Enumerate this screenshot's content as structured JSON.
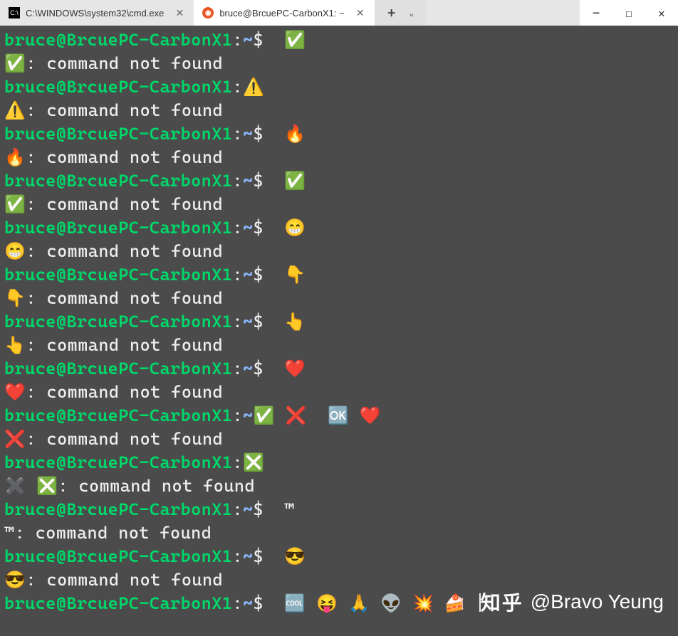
{
  "tabs": [
    {
      "title": "C:\\WINDOWS\\system32\\cmd.exe",
      "active": false,
      "icon": "cmd"
    },
    {
      "title": "bruce@BrcuePC-CarbonX1: ~",
      "active": true,
      "icon": "ubuntu"
    }
  ],
  "window": {
    "new_tab": "+",
    "dropdown": "⌄",
    "minimize": "—",
    "maximize": "☐",
    "close": "✕"
  },
  "prompt": {
    "host": "bruce@BrcuePC-CarbonX1",
    "sep": ":",
    "path": "~",
    "dollar": "$"
  },
  "error_text": ": command not found",
  "lines": [
    {
      "t": "prompt",
      "cmd": " ✅"
    },
    {
      "t": "out",
      "pre": "✅",
      "msg": ": command not found"
    },
    {
      "t": "prompt_nopath",
      "cmd": "⚠️"
    },
    {
      "t": "out",
      "pre": "⚠️",
      "msg": ": command not found"
    },
    {
      "t": "prompt",
      "cmd": " 🔥"
    },
    {
      "t": "out",
      "pre": "🔥",
      "msg": ": command not found"
    },
    {
      "t": "prompt",
      "cmd": " ✅"
    },
    {
      "t": "out",
      "pre": "✅",
      "msg": ": command not found"
    },
    {
      "t": "prompt",
      "cmd": " 😁"
    },
    {
      "t": "out",
      "pre": "😁",
      "msg": ": command not found"
    },
    {
      "t": "prompt",
      "cmd": " 👇"
    },
    {
      "t": "out",
      "pre": "👇",
      "msg": ": command not found"
    },
    {
      "t": "prompt",
      "cmd": " 👆"
    },
    {
      "t": "out",
      "pre": "👆",
      "msg": ": command not found"
    },
    {
      "t": "prompt",
      "cmd": " ❤️"
    },
    {
      "t": "out",
      "pre": "❤️",
      "msg": ": command not found"
    },
    {
      "t": "prompt_custom",
      "path": "~✅",
      "cmd": " ❌  🆗 ❤️"
    },
    {
      "t": "out",
      "pre": "❌",
      "msg": ": command not found"
    },
    {
      "t": "prompt_nopath",
      "cmd": "❎"
    },
    {
      "t": "out",
      "pre": "✖️ ❎",
      "msg": ": command not found"
    },
    {
      "t": "prompt",
      "cmd": " ™"
    },
    {
      "t": "out",
      "pre": "™",
      "msg": ": command not found"
    },
    {
      "t": "prompt",
      "cmd": " 😎"
    },
    {
      "t": "out",
      "pre": "😎",
      "msg": ": command not found"
    },
    {
      "t": "prompt",
      "cmd": " 🆒 😝 🙏 👽 💥 🍰 ",
      "cursor": true
    }
  ],
  "watermark": {
    "site": "知乎",
    "author": "@Bravo Yeung"
  }
}
